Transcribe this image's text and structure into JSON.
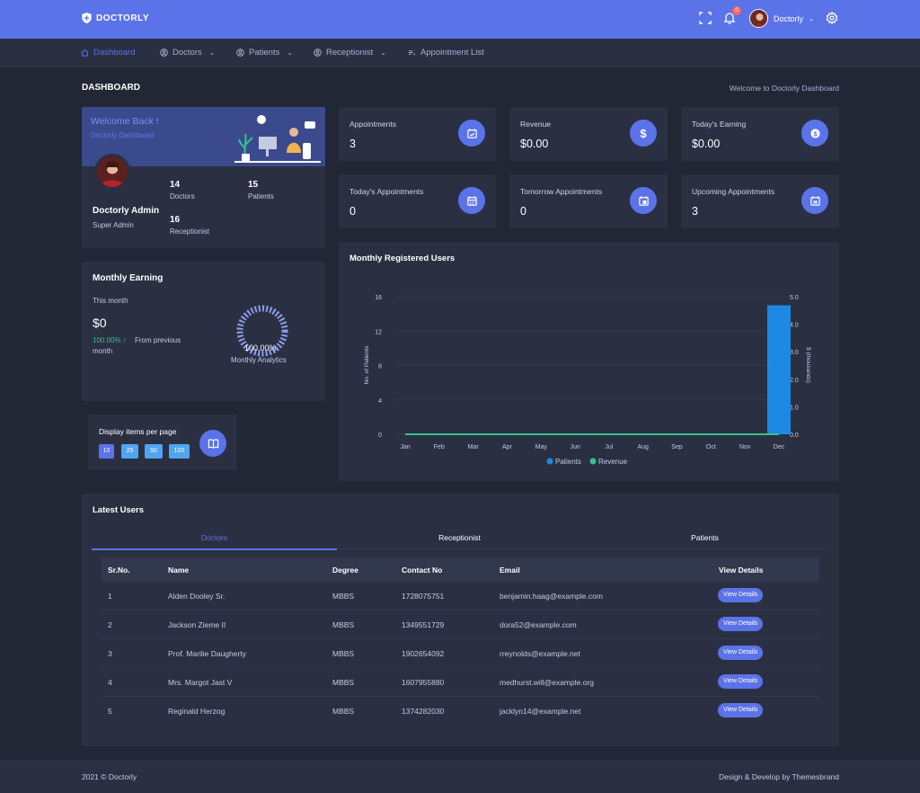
{
  "brand": {
    "name": "DOCTORLY",
    "logo_icon": "shield-icon"
  },
  "topbar": {
    "notification_count": "0",
    "user_name": "Doctorly",
    "icons": [
      "fullscreen-icon",
      "bell-icon",
      "gear-icon"
    ]
  },
  "nav": [
    {
      "label": "Dashboard",
      "icon": "home-icon",
      "active": true
    },
    {
      "label": "Doctors",
      "icon": "user-circle-icon",
      "has_dropdown": true
    },
    {
      "label": "Patients",
      "icon": "user-circle-icon",
      "has_dropdown": true
    },
    {
      "label": "Receptionist",
      "icon": "user-circle-icon",
      "has_dropdown": true
    },
    {
      "label": "Appointment List",
      "icon": "list-icon"
    }
  ],
  "page": {
    "title": "DASHBOARD",
    "welcome": "Welcome to Doctorly Dashboard"
  },
  "profile": {
    "welcome": "Welcome Back !",
    "subtitle": "Doctorly Dashboard",
    "name": "Doctorly Admin",
    "role": "Super Admin",
    "stats": [
      {
        "value": "14",
        "label": "Doctors"
      },
      {
        "value": "15",
        "label": "Patients"
      },
      {
        "value": "16",
        "label": "Receptionist"
      }
    ]
  },
  "stat_cards": [
    {
      "label": "Appointments",
      "value": "3",
      "icon": "calendar-check-icon"
    },
    {
      "label": "Revenue",
      "value": "$0.00",
      "icon": "dollar-icon"
    },
    {
      "label": "Today's Earning",
      "value": "$0.00",
      "icon": "coin-icon"
    },
    {
      "label": "Today's Appointments",
      "value": "0",
      "icon": "calendar-icon"
    },
    {
      "label": "Tomorrow Appointments",
      "value": "0",
      "icon": "calendar-day-icon"
    },
    {
      "label": "Upcoming Appointments",
      "value": "3",
      "icon": "calendar-list-icon"
    }
  ],
  "monthly_earning": {
    "title": "Monthly Earning",
    "subtitle": "This month",
    "value": "$0",
    "change": "100.00% ↑",
    "change_text": "From previous",
    "change_text2": "month",
    "gauge_percent": "100.00%",
    "gauge_value": 100,
    "gauge_label": "Monthly Analytics"
  },
  "display_items": {
    "title": "Display items per page",
    "options": [
      "10",
      "25",
      "50",
      "100"
    ],
    "selected": "10",
    "icon": "book-icon"
  },
  "chart_data": {
    "type": "bar",
    "title": "Monthly Registered Users",
    "categories": [
      "Jan",
      "Feb",
      "Mar",
      "Apr",
      "May",
      "Jun",
      "Jul",
      "Aug",
      "Sep",
      "Oct",
      "Nov",
      "Dec"
    ],
    "series": [
      {
        "name": "Patients",
        "type": "bar",
        "axis": "left",
        "color": "#1e88e5",
        "values": [
          0,
          0,
          0,
          0,
          0,
          0,
          0,
          0,
          0,
          0,
          0,
          15
        ]
      },
      {
        "name": "Revenue",
        "type": "line",
        "axis": "right",
        "color": "#34c38f",
        "values": [
          0,
          0,
          0,
          0,
          0,
          0,
          0,
          0,
          0,
          0,
          0,
          0
        ]
      }
    ],
    "ylabel_left": "No. of Patients",
    "ylabel_right": "$ (thousands)",
    "y_left_ticks": [
      "0",
      "4",
      "8",
      "12",
      "16"
    ],
    "y_right_ticks": [
      "0.0",
      "1.0",
      "2.0",
      "3.0",
      "4.0",
      "5.0"
    ],
    "ylim_left": [
      0,
      16
    ],
    "ylim_right": [
      0,
      5
    ],
    "grid": true,
    "legend": "bottom"
  },
  "latest_users": {
    "title": "Latest Users",
    "tabs": [
      "Doctors",
      "Receptionist",
      "Patients"
    ],
    "active_tab": "Doctors",
    "columns": [
      "Sr.No.",
      "Name",
      "Degree",
      "Contact No",
      "Email",
      "View Details"
    ],
    "rows": [
      {
        "no": "1",
        "name": "Alden Dooley Sr.",
        "degree": "MBBS",
        "contact": "1728075751",
        "email": "benjamin.haag@example.com"
      },
      {
        "no": "2",
        "name": "Jackson Zieme II",
        "degree": "MBBS",
        "contact": "1349551729",
        "email": "dora52@example.com"
      },
      {
        "no": "3",
        "name": "Prof. Marilie Daugherty",
        "degree": "MBBS",
        "contact": "1902654092",
        "email": "rreynolds@example.net"
      },
      {
        "no": "4",
        "name": "Mrs. Margot Jast V",
        "degree": "MBBS",
        "contact": "1607955880",
        "email": "medhurst.will@example.org"
      },
      {
        "no": "5",
        "name": "Reginald Herzog",
        "degree": "MBBS",
        "contact": "1374282030",
        "email": "jacklyn14@example.net"
      }
    ],
    "button_label": "View Details"
  },
  "footer": {
    "left": "2021 © Doctorly",
    "right": "Design & Develop by Themesbrand"
  },
  "colors": {
    "primary": "#5b73e8",
    "background": "#222736",
    "card": "#2a3042",
    "success": "#34c38f",
    "info": "#50a5f1",
    "danger": "#f46a6a"
  }
}
